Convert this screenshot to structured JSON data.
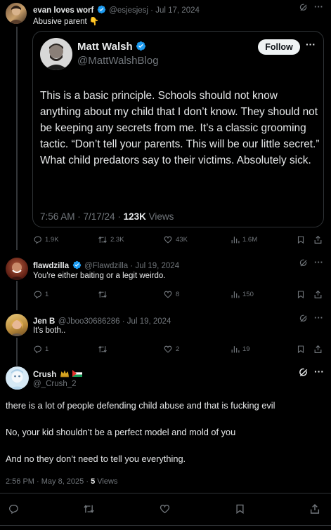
{
  "tweet1": {
    "name": "evan loves worf",
    "handle": "@esjesjesj",
    "date": "Jul 17, 2024",
    "text": "Abusive parent 👇",
    "quoted": {
      "name": "Matt Walsh",
      "handle": "@MattWalshBlog",
      "follow_label": "Follow",
      "text": "This is a basic principle. Schools should not know anything about my child that I don’t know. They should not be keeping any secrets from me. It’s a classic grooming tactic. “Don’t tell your parents. This will be our little secret.” What child predators say to their victims. Absolutely sick.",
      "time": "7:56 AM · 7/17/24 · ",
      "views_count": "123K",
      "views_label": " Views"
    },
    "replies": "1.9K",
    "retweets": "2.3K",
    "likes": "43K",
    "views": "1.6M"
  },
  "tweet2": {
    "name": "flawdzilla",
    "handle": "@Flawdzilla",
    "date": "Jul 19, 2024",
    "text": "You're either baiting or a legit weirdo.",
    "replies": "1",
    "likes": "8",
    "views": "150"
  },
  "tweet3": {
    "name": "Jen B",
    "handle": "@Jboo30686286",
    "date": "Jul 19, 2024",
    "text": "It's both..",
    "replies": "1",
    "likes": "2",
    "views": "19"
  },
  "main": {
    "name": "Crush",
    "handle": "@_Crush_2",
    "paragraphs": [
      "there is a lot of people defending child abuse and that is fucking evil",
      "No, your kid shouldn’t be a perfect model and mold of you",
      "And no they don’t need to tell you everything."
    ],
    "time": "2:56 PM · May 8, 2025 · ",
    "views_count": "5",
    "views_label": " Views"
  },
  "sep": " · ",
  "more": "···",
  "colors": {
    "verified": "#1d9bf0",
    "background": "#000000",
    "text": "#e7e9ea",
    "secondary": "#71767b",
    "border": "#2f3336"
  }
}
